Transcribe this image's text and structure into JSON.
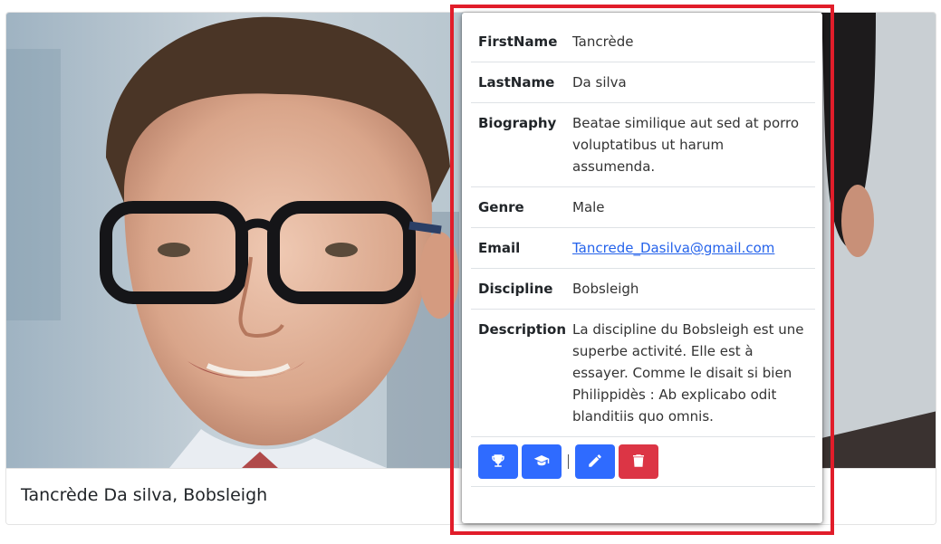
{
  "card": {
    "title": "Tancrède Da silva, Bobsleigh"
  },
  "details": {
    "rows": [
      {
        "label": "FirstName",
        "value": "Tancrède"
      },
      {
        "label": "LastName",
        "value": "Da silva"
      },
      {
        "label": "Biography",
        "value": "Beatae similique aut sed at porro voluptatibus ut harum assumenda."
      },
      {
        "label": "Genre",
        "value": "Male"
      },
      {
        "label": "Email",
        "value": "Tancrede_Dasilva@gmail.com"
      },
      {
        "label": "Discipline",
        "value": "Bobsleigh"
      },
      {
        "label": "Description",
        "value": "La discipline du Bobsleigh est une superbe activité. Elle est à essayer. Comme le disait si bien Philippidès : Ab explicabo odit blanditiis quo omnis."
      }
    ]
  },
  "actions": {
    "buttons": [
      {
        "icon": "trophy-icon",
        "color": "#2f6bff"
      },
      {
        "icon": "graduation-cap-icon",
        "color": "#2f6bff"
      },
      {
        "icon": "pencil-icon",
        "color": "#2f6bff"
      },
      {
        "icon": "trash-icon",
        "color": "#dc3545"
      }
    ]
  },
  "colors": {
    "primary": "#2f6bff",
    "danger": "#dc3545",
    "highlight": "#e11d2a"
  }
}
